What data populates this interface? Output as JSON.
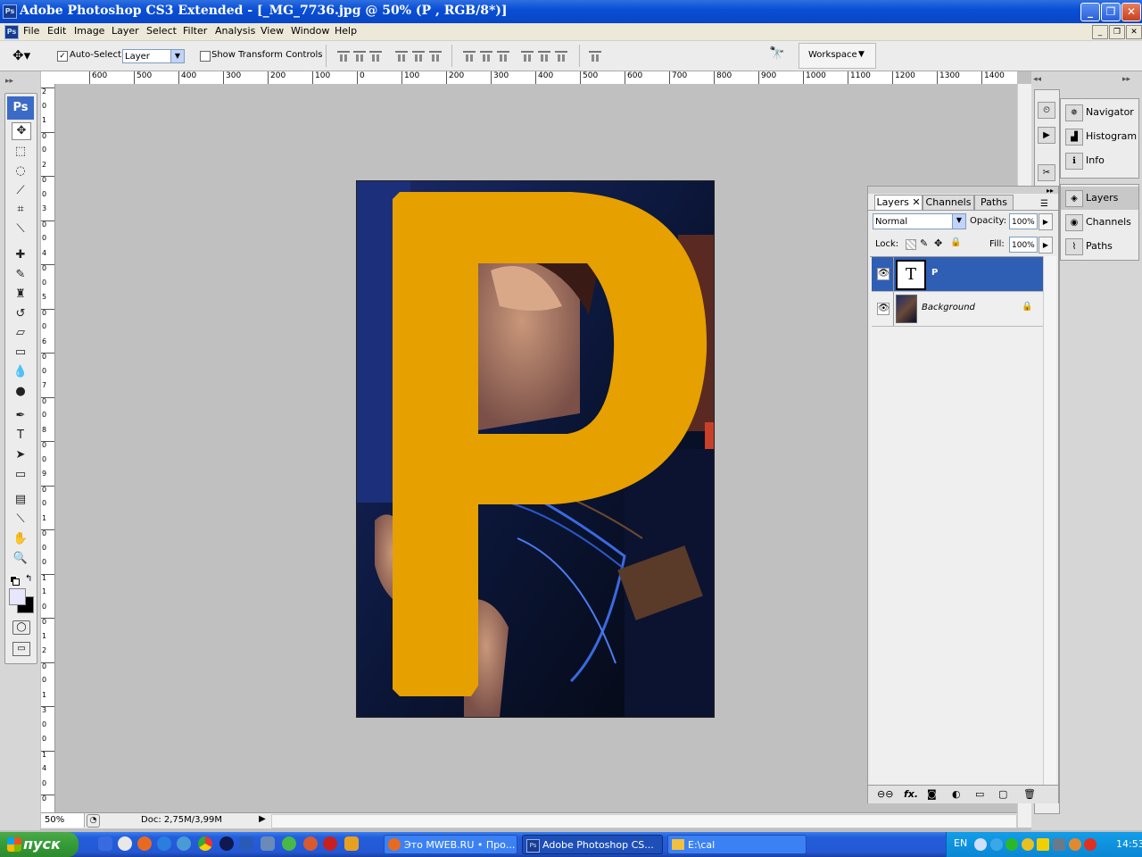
{
  "app": {
    "title": "Adobe Photoshop CS3 Extended - [_MG_7736.jpg @ 50% (P , RGB/8*)]",
    "ps_icon": "Ps"
  },
  "menu": {
    "items": [
      "File",
      "Edit",
      "Image",
      "Layer",
      "Select",
      "Filter",
      "Analysis",
      "View",
      "Window",
      "Help"
    ]
  },
  "options": {
    "auto_select_label": "Auto-Select:",
    "auto_select_checked": true,
    "auto_select_value": "Layer",
    "show_transform_label": "Show Transform Controls",
    "show_transform_checked": false,
    "workspace_label": "Workspace",
    "workspace_arrow": "▼"
  },
  "rulers": {
    "horizontal": [
      "600",
      "500",
      "400",
      "300",
      "200",
      "100",
      "0",
      "100",
      "200",
      "300",
      "400",
      "500",
      "600",
      "700",
      "800",
      "900",
      "1000",
      "1100",
      "1200",
      "1300",
      "1400"
    ],
    "vertical": [
      "2",
      "0",
      "1",
      "0",
      "0",
      "2",
      "0",
      "0",
      "3",
      "0",
      "0",
      "4",
      "0",
      "0",
      "5",
      "0",
      "0",
      "6",
      "0",
      "0",
      "7",
      "0",
      "0",
      "8",
      "0",
      "0",
      "9",
      "0",
      "0",
      "1",
      "0",
      "0",
      "0",
      "1",
      "1",
      "0",
      "0",
      "1",
      "2",
      "0",
      "0",
      "1",
      "3",
      "0",
      "0",
      "1",
      "4",
      "0",
      "0"
    ]
  },
  "toolbox": {
    "badge": "Ps",
    "tools": [
      {
        "name": "move-tool",
        "glyph": "✥"
      },
      {
        "name": "marquee-tool",
        "glyph": "⬚"
      },
      {
        "name": "lasso-tool",
        "glyph": "◌"
      },
      {
        "name": "magic-wand-tool",
        "glyph": "⟋"
      },
      {
        "name": "crop-tool",
        "glyph": "⌗"
      },
      {
        "name": "eyedropper-tool",
        "glyph": "⟍"
      },
      {
        "name": "healing-brush-tool",
        "glyph": "✚"
      },
      {
        "name": "brush-tool",
        "glyph": "✎"
      },
      {
        "name": "clone-stamp-tool",
        "glyph": "♜"
      },
      {
        "name": "history-brush-tool",
        "glyph": "↺"
      },
      {
        "name": "eraser-tool",
        "glyph": "▱"
      },
      {
        "name": "gradient-tool",
        "glyph": "▭"
      },
      {
        "name": "blur-tool",
        "glyph": "💧"
      },
      {
        "name": "dodge-tool",
        "glyph": "●"
      },
      {
        "name": "pen-tool",
        "glyph": "✒"
      },
      {
        "name": "type-tool",
        "glyph": "T"
      },
      {
        "name": "path-selection-tool",
        "glyph": "➤"
      },
      {
        "name": "shape-tool",
        "glyph": "▭"
      },
      {
        "name": "notes-tool",
        "glyph": "▤"
      },
      {
        "name": "color-sampler-tool",
        "glyph": "⟍"
      },
      {
        "name": "hand-tool",
        "glyph": "✋"
      },
      {
        "name": "zoom-tool",
        "glyph": "🔍"
      }
    ]
  },
  "canvas": {
    "letter": "P",
    "letter_color": "#e6a000"
  },
  "status": {
    "zoom": "50%",
    "doc_info": "Doc: 2,75M/3,99M"
  },
  "dock": {
    "items": [
      "Navigator",
      "Histogram",
      "Info",
      "Layers",
      "Channels",
      "Paths"
    ]
  },
  "layers_panel": {
    "tabs": [
      "Layers",
      "Channels",
      "Paths"
    ],
    "blend_mode": "Normal",
    "opacity_label": "Opacity:",
    "opacity_value": "100%",
    "lock_label": "Lock:",
    "fill_label": "Fill:",
    "fill_value": "100%",
    "layers": [
      {
        "name": "P",
        "thumb": "T",
        "selected": true
      },
      {
        "name": "Background",
        "thumb": "",
        "selected": false,
        "locked": true
      }
    ],
    "footer_icons": [
      "link-icon",
      "fx-icon",
      "mask-icon",
      "adjustment-icon",
      "group-icon",
      "new-layer-icon",
      "trash-icon"
    ],
    "fx_label": "fx."
  },
  "taskbar": {
    "start_label": "пуск",
    "tasks": [
      {
        "label": "Это MWEB.RU • Про...",
        "active": false
      },
      {
        "label": "Adobe Photoshop CS...",
        "active": true
      },
      {
        "label": "E:\\cal",
        "active": false
      }
    ],
    "lang": "EN",
    "clock": "14:53"
  },
  "colors": {
    "accent": "#316ac5",
    "title_bar": "#0a4fd6",
    "letter": "#e6a000"
  }
}
